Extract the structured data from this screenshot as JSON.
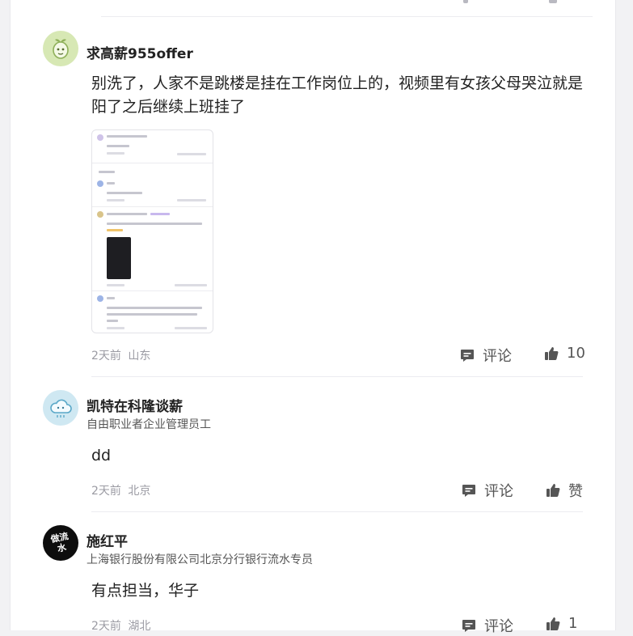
{
  "comments": [
    {
      "user": "求高薪955offer",
      "text": "别洗了，人家不是跳楼是挂在工作岗位上的，视频里有女孩父母哭泣就是阳了之后继续上班挂了",
      "time": "2天前",
      "location": "山东",
      "comment_label": "评论",
      "like_count": "10",
      "avatar": "green-sprout-avatar",
      "has_image": true
    },
    {
      "user": "凯特在科隆谈薪",
      "title": "自由职业者企业管理员工",
      "text": "dd",
      "time": "2天前",
      "location": "北京",
      "comment_label": "评论",
      "like_count": "赞",
      "avatar": "cloud-avatar"
    },
    {
      "user": "施红平",
      "title": "上海银行股份有限公司北京分行银行流水专员",
      "text": "有点担当，华子",
      "time": "2天前",
      "location": "湖北",
      "comment_label": "评论",
      "like_count": "1",
      "avatar": "black-circle-avatar",
      "avatar_text": "做流水"
    }
  ],
  "icons": {
    "comment": "comment-bubble-icon",
    "like": "thumbs-up-icon"
  },
  "colors": {
    "text": "#222222",
    "meta": "#9b9ba3",
    "divider": "#ececf0",
    "icon": "#555555"
  }
}
